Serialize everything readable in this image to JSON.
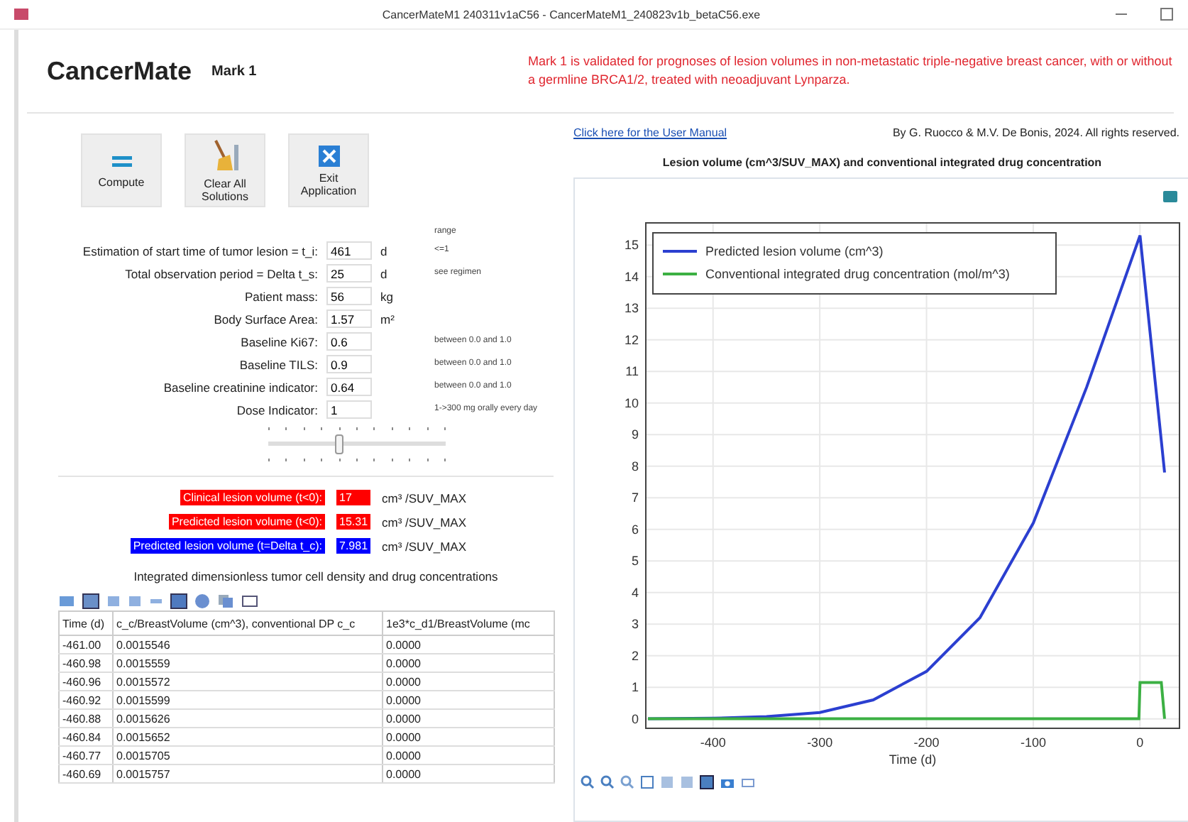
{
  "window": {
    "title": "CancerMateM1 240311v1aC56 - CancerMateM1_240823v1b_betaC56.exe"
  },
  "app": {
    "name": "CancerMate",
    "version": "Mark 1"
  },
  "notice": "Mark 1 is validated for prognoses of lesion volumes in non-metastatic triple-negative breast cancer, with or without a germline BRCA1/2, treated with neoadjuvant Lynparza.",
  "buttons": [
    {
      "kind": "equals",
      "label": "Compute"
    },
    {
      "kind": "broom",
      "label": "Clear All Solutions"
    },
    {
      "kind": "exit",
      "label": "Exit Application"
    }
  ],
  "inputs": {
    "range_header": "range",
    "rows": [
      {
        "label": "Estimation of start time of tumor lesion = t_i:",
        "value": "461",
        "unit": "d",
        "hint": "<=1"
      },
      {
        "label": "Total observation period = Delta t_s:",
        "value": "25",
        "unit": "d",
        "hint": "see regimen"
      },
      {
        "label": "Patient mass:",
        "value": "56",
        "unit": "kg"
      },
      {
        "label": "Body Surface Area:",
        "value": "1.57",
        "unit": "m²"
      },
      {
        "label": "Baseline Ki67:",
        "value": "0.6",
        "hint": "between 0.0 and 1.0"
      },
      {
        "label": "Baseline TILS:",
        "value": "0.9",
        "hint": "between 0.0 and 1.0"
      },
      {
        "label": "Baseline creatinine indicator:",
        "value": "0.64",
        "hint": "between 0.0 and 1.0"
      },
      {
        "label": "Dose Indicator:",
        "value": "1",
        "hint": "1->300 mg orally every day"
      }
    ]
  },
  "slider": {
    "level": 0.4
  },
  "outputs": [
    {
      "label": "Clinical lesion volume (t<0):",
      "value": "17",
      "unit": "cm³ /SUV_MAX",
      "color": "#ff0000"
    },
    {
      "label": "Predicted lesion volume (t<0):",
      "value": "15.31",
      "unit": "cm³ /SUV_MAX",
      "color": "#ff0000"
    },
    {
      "label": "Predicted lesion volume (t=Delta t_c):",
      "value": "7.981",
      "unit": "cm³ /SUV_MAX",
      "color": "#0000ff"
    }
  ],
  "table": {
    "title": "Integrated dimensionless tumor cell density and drug concentrations",
    "columns": [
      "Time (d)",
      "c_c/BreastVolume (cm^3), conventional DP c_c",
      "1e3*c_d1/BreastVolume (mc"
    ],
    "rows": [
      [
        "-461.00",
        "0.0015546",
        "0.0000"
      ],
      [
        "-460.98",
        "0.0015559",
        "0.0000"
      ],
      [
        "-460.96",
        "0.0015572",
        "0.0000"
      ],
      [
        "-460.92",
        "0.0015599",
        "0.0000"
      ],
      [
        "-460.88",
        "0.0015626",
        "0.0000"
      ],
      [
        "-460.84",
        "0.0015652",
        "0.0000"
      ],
      [
        "-460.77",
        "0.0015705",
        "0.0000"
      ],
      [
        "-460.69",
        "0.0015757",
        "0.0000"
      ]
    ]
  },
  "manual_link": "Click here for the User Manual",
  "credit": "By G. Ruocco & M.V. De Bonis, 2024. All rights reserved.",
  "chart_title": "Lesion volume (cm^3/SUV_MAX) and conventional integrated drug concentration",
  "chart_data": {
    "type": "line",
    "xlabel": "Time (d)",
    "x": [
      -461,
      -400,
      -350,
      -300,
      -250,
      -200,
      -150,
      -100,
      -50,
      -1,
      0,
      20,
      23
    ],
    "series": [
      {
        "name": "Predicted lesion volume (cm^3)",
        "color": "#2b3fd0",
        "values": [
          0,
          0.02,
          0.07,
          0.2,
          0.6,
          1.5,
          3.2,
          6.2,
          10.5,
          15.2,
          15.3,
          8.8,
          7.8
        ]
      },
      {
        "name": "Conventional integrated drug concentration (mol/m^3)",
        "color": "#3cb043",
        "values": [
          0,
          0,
          0,
          0,
          0,
          0,
          0,
          0,
          0,
          0,
          1.15,
          1.15,
          0
        ]
      }
    ],
    "grid": true,
    "legend": true,
    "xlim": [
      -463,
      37
    ],
    "ylim": [
      -0.3,
      15.7
    ],
    "xticks": [
      -400,
      -300,
      -200,
      -100,
      0
    ],
    "yticks": [
      0,
      1,
      2,
      3,
      4,
      5,
      6,
      7,
      8,
      9,
      10,
      11,
      12,
      13,
      14,
      15
    ]
  }
}
